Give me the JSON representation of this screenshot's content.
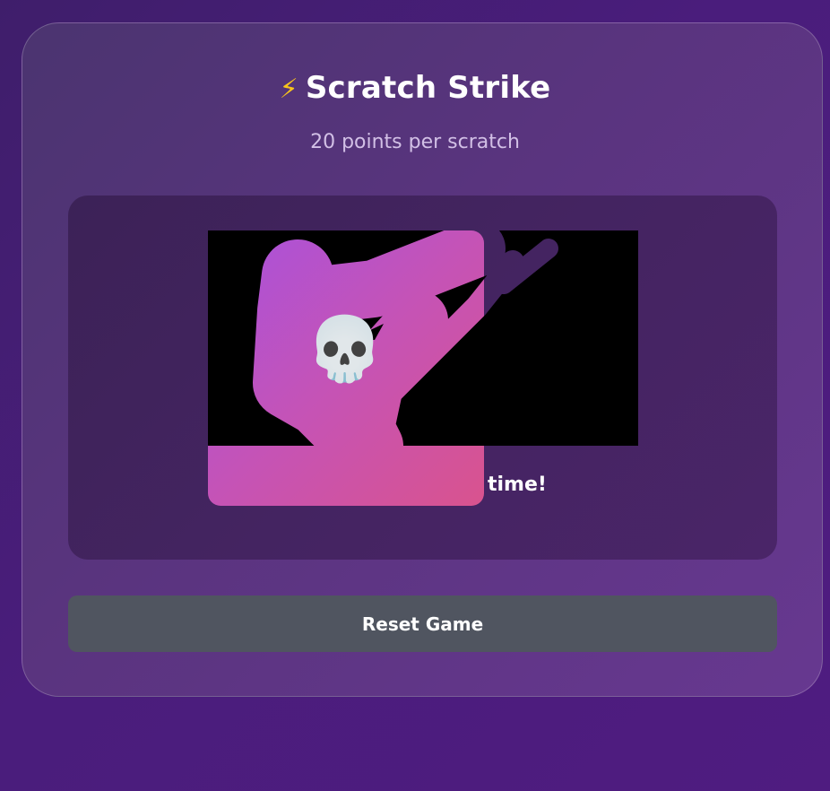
{
  "header": {
    "icon": "lightning-bolt-icon",
    "title": "Scratch Strike",
    "subtitle": "20 points per scratch"
  },
  "game": {
    "prize_text_visible": "time!",
    "revealed_symbol": "skull",
    "revealed_symbol_glyph": "💀"
  },
  "controls": {
    "reset_label": "Reset Game"
  },
  "colors": {
    "background": "#4a1d7c",
    "panel": "#5a347f",
    "board": "#442461",
    "scratch_cover": "#000000",
    "prize_gradient_start": "#a752de",
    "prize_gradient_end": "#d9538e",
    "reset_button": "#505560",
    "bolt": "#f7c41c"
  }
}
